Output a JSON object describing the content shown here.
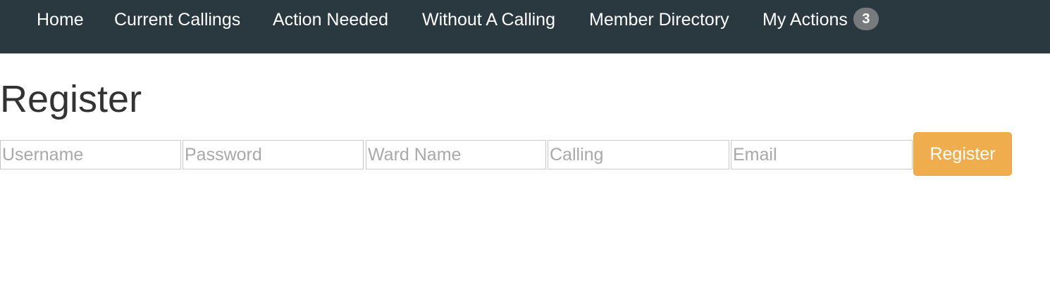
{
  "nav": {
    "items": [
      {
        "label": "Home"
      },
      {
        "label": "Current Callings"
      },
      {
        "label": "Action Needed"
      },
      {
        "label": "Without A Calling"
      },
      {
        "label": "Member Directory"
      },
      {
        "label": "My Actions",
        "badge": "3"
      }
    ],
    "background_color": "#2a3840"
  },
  "page": {
    "title": "Register"
  },
  "form": {
    "username_placeholder": "Username",
    "password_placeholder": "Password",
    "ward_name_placeholder": "Ward Name",
    "calling_placeholder": "Calling",
    "email_placeholder": "Email",
    "submit_label": "Register",
    "submit_color": "#f0ad4e"
  }
}
